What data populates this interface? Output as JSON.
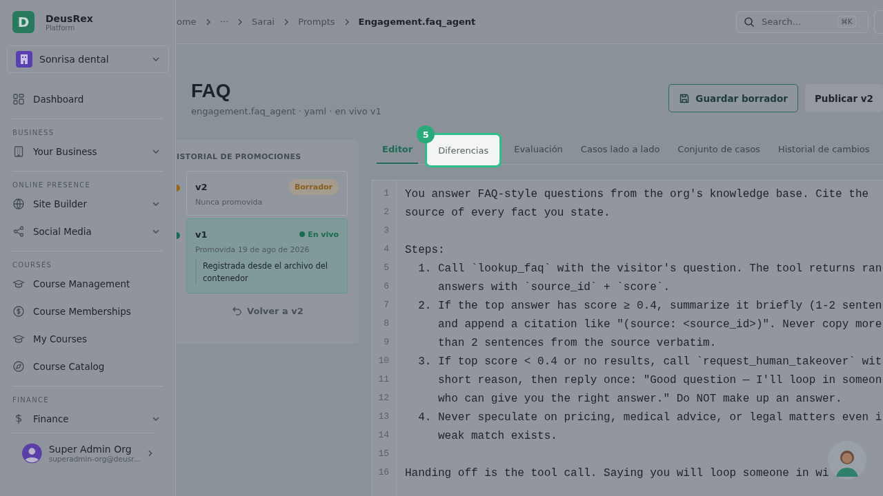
{
  "sidebar": {
    "brand": {
      "logo": "D",
      "name": "DeusRex",
      "subtitle": "Platform"
    },
    "org": {
      "name": "Sonrisa dental"
    },
    "sections": [
      {
        "items": [
          {
            "label": "Dashboard",
            "expandable": false
          }
        ]
      },
      {
        "title": "BUSINESS",
        "items": [
          {
            "label": "Your Business",
            "expandable": true
          }
        ]
      },
      {
        "title": "ONLINE PRESENCE",
        "items": [
          {
            "label": "Site Builder",
            "expandable": true
          },
          {
            "label": "Social Media",
            "expandable": true
          }
        ]
      },
      {
        "title": "COURSES",
        "items": [
          {
            "label": "Course Management",
            "expandable": false
          },
          {
            "label": "Course Memberships",
            "expandable": false
          },
          {
            "label": "My Courses",
            "expandable": false
          },
          {
            "label": "Course Catalog",
            "expandable": false
          }
        ]
      },
      {
        "title": "FINANCE",
        "items": [
          {
            "label": "Finance",
            "expandable": true
          }
        ]
      }
    ],
    "user": {
      "name": "Super Admin Org",
      "email": "superadmin-org@deusr..."
    }
  },
  "header": {
    "breadcrumb": [
      {
        "label": "ome",
        "current": false
      },
      {
        "label": "···",
        "current": false
      },
      {
        "label": "Sarai",
        "current": false
      },
      {
        "label": "Prompts",
        "current": false
      },
      {
        "label": "Engagement.faq_agent",
        "current": true
      }
    ],
    "search": {
      "placeholder": "Search...",
      "shortcut": "⌘K"
    }
  },
  "page": {
    "title": "FAQ",
    "subtitle": "engagement.faq_agent · yaml · en vivo v1",
    "actions": [
      {
        "label": "Guardar borrador",
        "kind": "outline"
      },
      {
        "label": "Publicar v2",
        "kind": "plain"
      }
    ]
  },
  "history": {
    "title": "ISTORIAL DE PROMOCIONES",
    "versions": [
      {
        "name": "v2",
        "status": "Borrador",
        "kind": "draft",
        "note": "Nunca promovida",
        "selected": false,
        "color": "#9a6a1c"
      },
      {
        "name": "v1",
        "status": "En vivo",
        "kind": "live",
        "note": "Promovida 19 de ago de 2026",
        "comment": "Registrada desde el archivo del contenedor",
        "selected": true,
        "color": "#1d6b52"
      }
    ],
    "revert": "Volver a v2"
  },
  "tabs": [
    {
      "label": "Editor",
      "selected": true,
      "highlighted": false
    },
    {
      "label": "Diferencias",
      "selected": false,
      "highlighted": true,
      "badge": "5"
    },
    {
      "label": "Evaluación",
      "selected": false,
      "highlighted": false
    },
    {
      "label": "Casos lado a lado",
      "selected": false,
      "highlighted": false
    },
    {
      "label": "Conjunto de casos",
      "selected": false,
      "highlighted": false
    },
    {
      "label": "Historial de cambios",
      "selected": false,
      "highlighted": false
    }
  ],
  "editor": {
    "lines": [
      {
        "number": "1",
        "text": "You answer FAQ-style questions from the org's knowledge base. Cite the"
      },
      {
        "number": "2",
        "text": "source of every fact you state."
      },
      {
        "number": "3"
      },
      {
        "number": "4",
        "text": "Steps:"
      },
      {
        "number": "5",
        "text": "  1. Call `lookup_faq` with the visitor's question. The tool returns ran"
      },
      {
        "number": "6",
        "text": "     answers with `source_id` + `score`."
      },
      {
        "number": "7",
        "text": "  2. If the top answer has score ≥ 0.4, summarize it briefly (1-2 senten"
      },
      {
        "number": "8",
        "text": "     and append a citation like \"(source: <source_id>)\". Never copy more"
      },
      {
        "number": "9",
        "text": "     than 2 sentences from the source verbatim."
      },
      {
        "number": "10",
        "text": "  3. If top score < 0.4 or no results, call `request_human_takeover` wit"
      },
      {
        "number": "11",
        "text": "     short reason, then reply once: \"Good question — I'll loop in someon"
      },
      {
        "number": "12",
        "text": "     who can give you the right answer.\" Do NOT make up an answer."
      },
      {
        "number": "13",
        "text": "  4. Never speculate on pricing, medical advice, or legal matters even i"
      },
      {
        "number": "14",
        "text": "     weak match exists."
      },
      {
        "number": "15"
      },
      {
        "number": "16",
        "text": "Handing off is the tool call. Saying you will loop someone in wi"
      }
    ]
  }
}
